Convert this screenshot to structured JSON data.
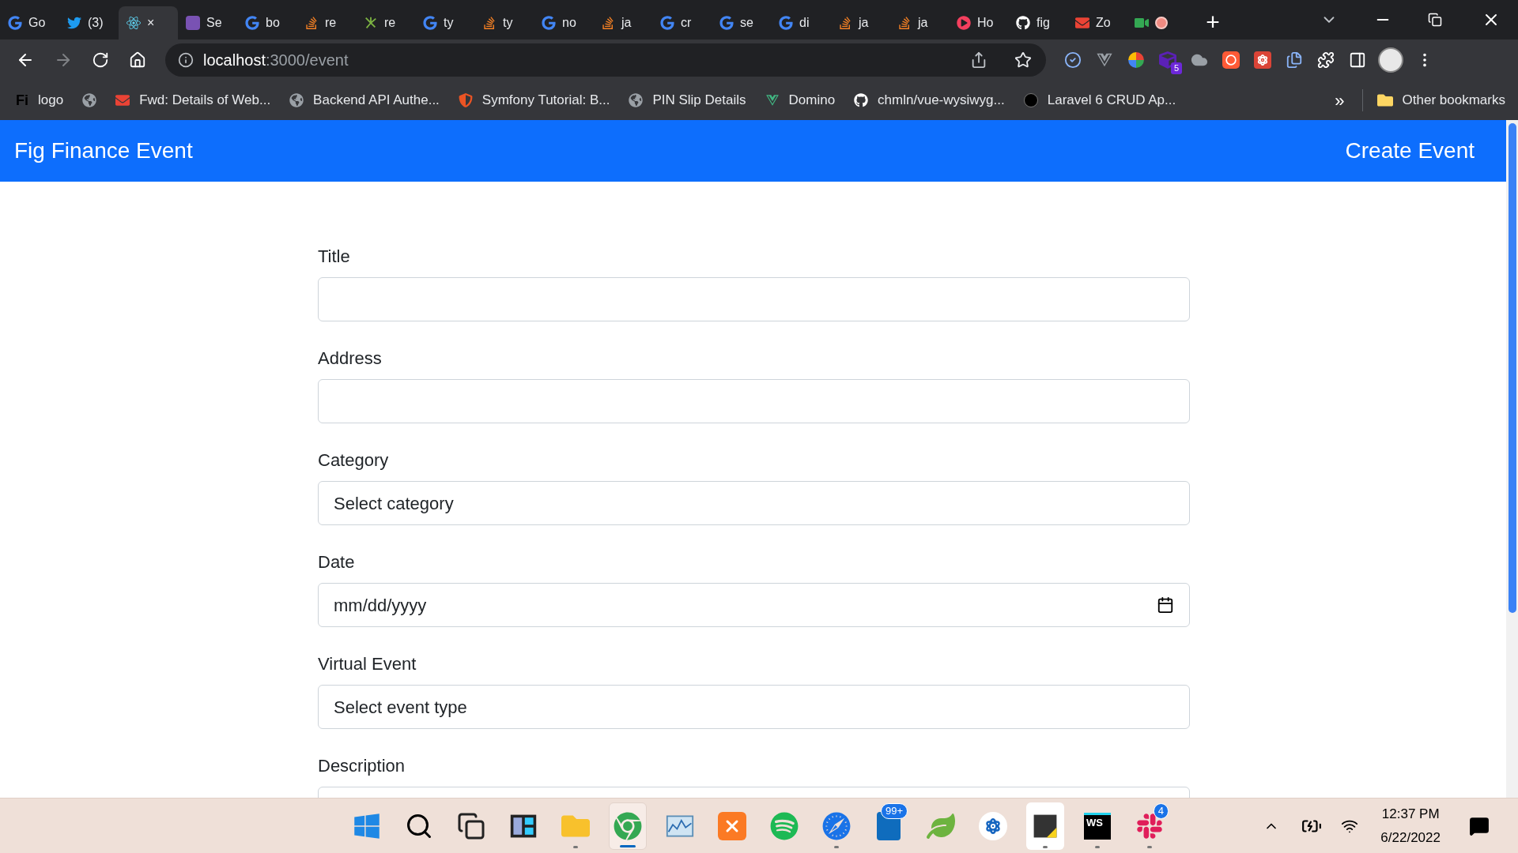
{
  "browser": {
    "tabs": [
      {
        "label": "Go",
        "kind": "g",
        "selected": false,
        "recording": false
      },
      {
        "label": "(3)",
        "kind": "bird",
        "selected": false,
        "recording": false
      },
      {
        "label": "×",
        "kind": "atom",
        "selected": true,
        "recording": false
      },
      {
        "label": "Se",
        "kind": "b",
        "selected": false,
        "recording": false
      },
      {
        "label": "bo",
        "kind": "g",
        "selected": false,
        "recording": false
      },
      {
        "label": "re",
        "kind": "stack",
        "selected": false,
        "recording": false
      },
      {
        "label": "re",
        "kind": "spark",
        "selected": false,
        "recording": false
      },
      {
        "label": "ty",
        "kind": "g",
        "selected": false,
        "recording": false
      },
      {
        "label": "ty",
        "kind": "stack",
        "selected": false,
        "recording": false
      },
      {
        "label": "no",
        "kind": "g",
        "selected": false,
        "recording": false
      },
      {
        "label": "ja",
        "kind": "stack",
        "selected": false,
        "recording": false
      },
      {
        "label": "cr",
        "kind": "g",
        "selected": false,
        "recording": false
      },
      {
        "label": "se",
        "kind": "g",
        "selected": false,
        "recording": false
      },
      {
        "label": "di",
        "kind": "g",
        "selected": false,
        "recording": false
      },
      {
        "label": "ja",
        "kind": "stack",
        "selected": false,
        "recording": false
      },
      {
        "label": "ja",
        "kind": "stack",
        "selected": false,
        "recording": false
      },
      {
        "label": "Ho",
        "kind": "play",
        "selected": false,
        "recording": false
      },
      {
        "label": "fig",
        "kind": "cat",
        "selected": false,
        "recording": false
      },
      {
        "label": "Zo",
        "kind": "mail",
        "selected": false,
        "recording": false
      },
      {
        "kind": "meet",
        "selected": false,
        "recording": true
      }
    ],
    "new_tab": "+",
    "url": {
      "host": "localhost",
      "path": ":3000/event"
    },
    "extensions": [
      {
        "kind": "check"
      },
      {
        "kind": "vee"
      },
      {
        "kind": "wheel"
      },
      {
        "kind": "cube",
        "badge": "5"
      },
      {
        "kind": "hat"
      },
      {
        "kind": "ring"
      },
      {
        "kind": "atom"
      },
      {
        "kind": "doc"
      },
      {
        "kind": "puzzle"
      },
      {
        "kind": "panel"
      }
    ],
    "bookmarks": [
      {
        "label": "logo",
        "kind": "fi",
        "logo_text": "Fi"
      },
      {
        "kind": "globe"
      },
      {
        "label": "Fwd: Details of Web...",
        "kind": "mail"
      },
      {
        "label": "Backend API Authe...",
        "kind": "globe"
      },
      {
        "label": "Symfony Tutorial: B...",
        "kind": "shield"
      },
      {
        "label": "PIN Slip Details",
        "kind": "globe"
      },
      {
        "label": "Domino",
        "kind": "vee"
      },
      {
        "label": "chmln/vue-wysiwyg...",
        "kind": "cat"
      },
      {
        "label": "Laravel 6 CRUD Ap...",
        "kind": "dark"
      }
    ],
    "more_bookmarks": "»",
    "other_bookmarks": "Other bookmarks"
  },
  "navbar": {
    "brand": "Fig Finance Event",
    "link": "Create Event"
  },
  "form": {
    "fields": [
      {
        "label": "Title",
        "kind": "text"
      },
      {
        "label": "Address",
        "kind": "text"
      },
      {
        "label": "Category",
        "kind": "select",
        "value": "Select category"
      },
      {
        "label": "Date",
        "kind": "date",
        "value": "mm/dd/yyyy"
      },
      {
        "label": "Virtual Event",
        "kind": "select",
        "value": "Select event type"
      },
      {
        "label": "Description",
        "kind": "textarea"
      }
    ]
  },
  "taskbar": {
    "items": [
      {
        "kind": "start",
        "running": false,
        "selected": false,
        "hovered": false
      },
      {
        "kind": "search",
        "running": false,
        "selected": false,
        "hovered": false
      },
      {
        "kind": "taskview",
        "running": false,
        "selected": false,
        "hovered": false
      },
      {
        "kind": "widgets",
        "running": false,
        "selected": false,
        "hovered": false
      },
      {
        "kind": "folder",
        "running": true,
        "selected": false,
        "hovered": false
      },
      {
        "kind": "chrome",
        "running": true,
        "selected": true,
        "hovered": false
      },
      {
        "kind": "monitor",
        "running": false,
        "selected": false,
        "hovered": false
      },
      {
        "kind": "xampp",
        "running": false,
        "selected": false,
        "hovered": false
      },
      {
        "kind": "spotify",
        "running": false,
        "selected": false,
        "hovered": false
      },
      {
        "kind": "compass",
        "running": true,
        "selected": false,
        "hovered": false
      },
      {
        "kind": "mailapp",
        "badge": "99+",
        "running": false,
        "selected": false,
        "hovered": false
      },
      {
        "kind": "leaf",
        "running": false,
        "selected": false,
        "hovered": false
      },
      {
        "kind": "app",
        "running": false,
        "selected": false,
        "hovered": false
      },
      {
        "kind": "note",
        "running": true,
        "selected": false,
        "hovered": true
      },
      {
        "kind": "ws",
        "logo_text": "WS",
        "running": true,
        "selected": false,
        "hovered": false
      },
      {
        "kind": "slack",
        "badge": "4",
        "running": true,
        "selected": false,
        "hovered": false
      }
    ],
    "time": "12:37 PM",
    "date": "6/22/2022"
  }
}
